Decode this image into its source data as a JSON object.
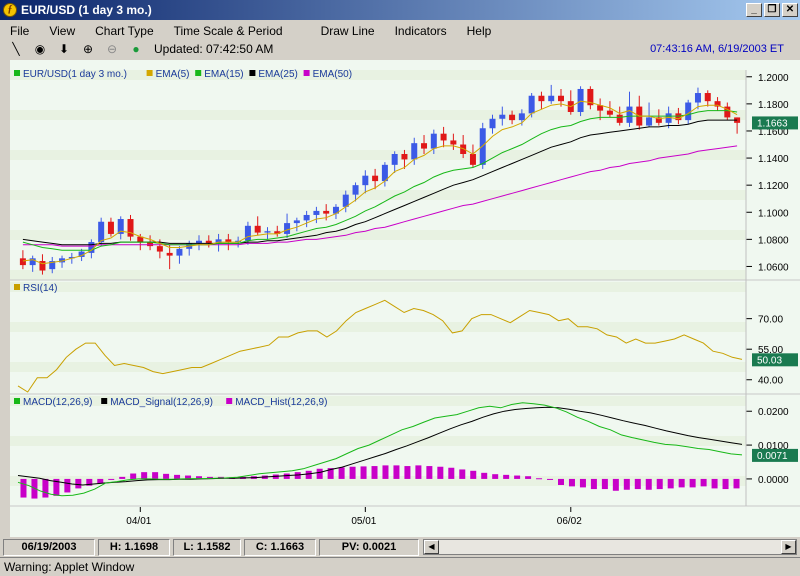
{
  "window": {
    "title": "EUR/USD (1 day  3 mo.)",
    "buttons": [
      "_",
      "❐",
      "✕"
    ]
  },
  "menu": [
    "File",
    "View",
    "Chart Type",
    "Time Scale & Period",
    "Draw Line",
    "Indicators",
    "Help"
  ],
  "toolbar": {
    "updated": "Updated: 07:42:50 AM",
    "clock": "07:43:16 AM, 6/19/2003 ET"
  },
  "status": {
    "date": "06/19/2003",
    "high": "H: 1.1698",
    "low": "L: 1.1582",
    "close": "C: 1.1663",
    "pv": "PV: 0.0021"
  },
  "warning": "Warning: Applet Window",
  "colors": {
    "up": "#3c5ae6",
    "down": "#e01818",
    "ema5": "#d4a800",
    "ema15": "#18b818",
    "ema25": "#000000",
    "ema50": "#c800c8",
    "rsi": "#c8a000",
    "macd": "#18b818",
    "signal": "#000000",
    "hist": "#c800c8",
    "last_badge": "#1a7a50"
  },
  "chart_data": [
    {
      "type": "candlestick",
      "legend": [
        "EUR/USD(1 day  3 mo.)",
        "EMA(5)",
        "EMA(15)",
        "EMA(25)",
        "EMA(50)"
      ],
      "yticks": [
        "1.2000",
        "1.1800",
        "1.1600",
        "1.1400",
        "1.1200",
        "1.1000",
        "1.0800",
        "1.0600"
      ],
      "ylim": [
        1.05,
        1.205
      ],
      "last_value": "1.1663",
      "xticks": [
        {
          "index": 12,
          "label": "04/01"
        },
        {
          "index": 35,
          "label": "05/01"
        },
        {
          "index": 56,
          "label": "06/02"
        }
      ],
      "candles": [
        {
          "o": 1.066,
          "h": 1.072,
          "l": 1.058,
          "c": 1.061
        },
        {
          "o": 1.061,
          "h": 1.068,
          "l": 1.056,
          "c": 1.066
        },
        {
          "o": 1.064,
          "h": 1.069,
          "l": 1.054,
          "c": 1.057
        },
        {
          "o": 1.058,
          "h": 1.067,
          "l": 1.055,
          "c": 1.064
        },
        {
          "o": 1.063,
          "h": 1.068,
          "l": 1.059,
          "c": 1.066
        },
        {
          "o": 1.066,
          "h": 1.07,
          "l": 1.062,
          "c": 1.067
        },
        {
          "o": 1.067,
          "h": 1.073,
          "l": 1.064,
          "c": 1.071
        },
        {
          "o": 1.07,
          "h": 1.08,
          "l": 1.066,
          "c": 1.078
        },
        {
          "o": 1.078,
          "h": 1.096,
          "l": 1.075,
          "c": 1.093
        },
        {
          "o": 1.093,
          "h": 1.096,
          "l": 1.082,
          "c": 1.084
        },
        {
          "o": 1.084,
          "h": 1.097,
          "l": 1.08,
          "c": 1.095
        },
        {
          "o": 1.095,
          "h": 1.098,
          "l": 1.079,
          "c": 1.082
        },
        {
          "o": 1.082,
          "h": 1.084,
          "l": 1.072,
          "c": 1.078
        },
        {
          "o": 1.078,
          "h": 1.083,
          "l": 1.072,
          "c": 1.075
        },
        {
          "o": 1.075,
          "h": 1.08,
          "l": 1.066,
          "c": 1.071
        },
        {
          "o": 1.07,
          "h": 1.076,
          "l": 1.058,
          "c": 1.068
        },
        {
          "o": 1.068,
          "h": 1.075,
          "l": 1.062,
          "c": 1.073
        },
        {
          "o": 1.073,
          "h": 1.079,
          "l": 1.068,
          "c": 1.077
        },
        {
          "o": 1.077,
          "h": 1.083,
          "l": 1.072,
          "c": 1.079
        },
        {
          "o": 1.079,
          "h": 1.083,
          "l": 1.074,
          "c": 1.077
        },
        {
          "o": 1.077,
          "h": 1.084,
          "l": 1.071,
          "c": 1.08
        },
        {
          "o": 1.08,
          "h": 1.084,
          "l": 1.072,
          "c": 1.078
        },
        {
          "o": 1.078,
          "h": 1.082,
          "l": 1.074,
          "c": 1.079
        },
        {
          "o": 1.079,
          "h": 1.093,
          "l": 1.076,
          "c": 1.09
        },
        {
          "o": 1.09,
          "h": 1.097,
          "l": 1.083,
          "c": 1.085
        },
        {
          "o": 1.085,
          "h": 1.089,
          "l": 1.08,
          "c": 1.086
        },
        {
          "o": 1.086,
          "h": 1.09,
          "l": 1.082,
          "c": 1.084
        },
        {
          "o": 1.084,
          "h": 1.099,
          "l": 1.081,
          "c": 1.092
        },
        {
          "o": 1.092,
          "h": 1.096,
          "l": 1.086,
          "c": 1.094
        },
        {
          "o": 1.094,
          "h": 1.101,
          "l": 1.089,
          "c": 1.098
        },
        {
          "o": 1.098,
          "h": 1.104,
          "l": 1.092,
          "c": 1.101
        },
        {
          "o": 1.101,
          "h": 1.106,
          "l": 1.094,
          "c": 1.099
        },
        {
          "o": 1.099,
          "h": 1.106,
          "l": 1.095,
          "c": 1.104
        },
        {
          "o": 1.104,
          "h": 1.116,
          "l": 1.1,
          "c": 1.113
        },
        {
          "o": 1.113,
          "h": 1.122,
          "l": 1.108,
          "c": 1.12
        },
        {
          "o": 1.12,
          "h": 1.131,
          "l": 1.114,
          "c": 1.127
        },
        {
          "o": 1.127,
          "h": 1.132,
          "l": 1.117,
          "c": 1.123
        },
        {
          "o": 1.123,
          "h": 1.137,
          "l": 1.119,
          "c": 1.135
        },
        {
          "o": 1.135,
          "h": 1.145,
          "l": 1.129,
          "c": 1.143
        },
        {
          "o": 1.143,
          "h": 1.146,
          "l": 1.132,
          "c": 1.139
        },
        {
          "o": 1.139,
          "h": 1.155,
          "l": 1.135,
          "c": 1.151
        },
        {
          "o": 1.151,
          "h": 1.157,
          "l": 1.143,
          "c": 1.147
        },
        {
          "o": 1.147,
          "h": 1.161,
          "l": 1.143,
          "c": 1.158
        },
        {
          "o": 1.158,
          "h": 1.163,
          "l": 1.148,
          "c": 1.153
        },
        {
          "o": 1.153,
          "h": 1.158,
          "l": 1.146,
          "c": 1.15
        },
        {
          "o": 1.15,
          "h": 1.157,
          "l": 1.14,
          "c": 1.143
        },
        {
          "o": 1.143,
          "h": 1.15,
          "l": 1.133,
          "c": 1.135
        },
        {
          "o": 1.135,
          "h": 1.166,
          "l": 1.132,
          "c": 1.162
        },
        {
          "o": 1.162,
          "h": 1.172,
          "l": 1.158,
          "c": 1.169
        },
        {
          "o": 1.169,
          "h": 1.178,
          "l": 1.164,
          "c": 1.172
        },
        {
          "o": 1.172,
          "h": 1.175,
          "l": 1.165,
          "c": 1.168
        },
        {
          "o": 1.168,
          "h": 1.176,
          "l": 1.164,
          "c": 1.173
        },
        {
          "o": 1.173,
          "h": 1.188,
          "l": 1.17,
          "c": 1.186
        },
        {
          "o": 1.186,
          "h": 1.189,
          "l": 1.176,
          "c": 1.182
        },
        {
          "o": 1.182,
          "h": 1.194,
          "l": 1.18,
          "c": 1.186
        },
        {
          "o": 1.186,
          "h": 1.191,
          "l": 1.178,
          "c": 1.182
        },
        {
          "o": 1.182,
          "h": 1.19,
          "l": 1.172,
          "c": 1.174
        },
        {
          "o": 1.174,
          "h": 1.193,
          "l": 1.171,
          "c": 1.191
        },
        {
          "o": 1.191,
          "h": 1.193,
          "l": 1.176,
          "c": 1.179
        },
        {
          "o": 1.179,
          "h": 1.184,
          "l": 1.168,
          "c": 1.175
        },
        {
          "o": 1.175,
          "h": 1.182,
          "l": 1.17,
          "c": 1.172
        },
        {
          "o": 1.172,
          "h": 1.178,
          "l": 1.164,
          "c": 1.166
        },
        {
          "o": 1.166,
          "h": 1.189,
          "l": 1.163,
          "c": 1.178
        },
        {
          "o": 1.178,
          "h": 1.186,
          "l": 1.161,
          "c": 1.164
        },
        {
          "o": 1.164,
          "h": 1.181,
          "l": 1.163,
          "c": 1.17
        },
        {
          "o": 1.17,
          "h": 1.176,
          "l": 1.164,
          "c": 1.166
        },
        {
          "o": 1.166,
          "h": 1.178,
          "l": 1.162,
          "c": 1.173
        },
        {
          "o": 1.173,
          "h": 1.177,
          "l": 1.165,
          "c": 1.168
        },
        {
          "o": 1.168,
          "h": 1.183,
          "l": 1.165,
          "c": 1.181
        },
        {
          "o": 1.181,
          "h": 1.192,
          "l": 1.176,
          "c": 1.188
        },
        {
          "o": 1.188,
          "h": 1.19,
          "l": 1.178,
          "c": 1.182
        },
        {
          "o": 1.182,
          "h": 1.185,
          "l": 1.175,
          "c": 1.178
        },
        {
          "o": 1.178,
          "h": 1.181,
          "l": 1.168,
          "c": 1.17
        },
        {
          "o": 1.17,
          "h": 1.17,
          "l": 1.158,
          "c": 1.166
        }
      ],
      "ema5": [
        1.064,
        1.065,
        1.062,
        1.063,
        1.064,
        1.066,
        1.068,
        1.072,
        1.079,
        1.081,
        1.086,
        1.085,
        1.082,
        1.08,
        1.077,
        1.074,
        1.074,
        1.075,
        1.076,
        1.076,
        1.078,
        1.078,
        1.078,
        1.082,
        1.083,
        1.084,
        1.084,
        1.087,
        1.089,
        1.092,
        1.095,
        1.096,
        1.099,
        1.104,
        1.109,
        1.115,
        1.118,
        1.123,
        1.13,
        1.133,
        1.139,
        1.142,
        1.147,
        1.149,
        1.149,
        1.147,
        1.143,
        1.149,
        1.156,
        1.161,
        1.163,
        1.166,
        1.173,
        1.176,
        1.179,
        1.18,
        1.178,
        1.182,
        1.181,
        1.179,
        1.177,
        1.173,
        1.175,
        1.171,
        1.171,
        1.169,
        1.17,
        1.169,
        1.173,
        1.178,
        1.179,
        1.179,
        1.176,
        1.172
      ],
      "ema15": [
        1.078,
        1.076,
        1.074,
        1.073,
        1.072,
        1.072,
        1.072,
        1.072,
        1.075,
        1.076,
        1.078,
        1.078,
        1.078,
        1.078,
        1.077,
        1.076,
        1.076,
        1.076,
        1.076,
        1.076,
        1.077,
        1.077,
        1.077,
        1.079,
        1.08,
        1.08,
        1.081,
        1.082,
        1.084,
        1.086,
        1.088,
        1.089,
        1.091,
        1.094,
        1.097,
        1.101,
        1.104,
        1.108,
        1.112,
        1.115,
        1.119,
        1.122,
        1.126,
        1.129,
        1.131,
        1.132,
        1.133,
        1.136,
        1.14,
        1.144,
        1.147,
        1.15,
        1.154,
        1.158,
        1.161,
        1.163,
        1.164,
        1.167,
        1.169,
        1.17,
        1.17,
        1.17,
        1.171,
        1.171,
        1.171,
        1.171,
        1.171,
        1.171,
        1.172,
        1.174,
        1.175,
        1.175,
        1.175,
        1.174
      ],
      "ema25": [
        1.08,
        1.079,
        1.078,
        1.077,
        1.076,
        1.076,
        1.076,
        1.076,
        1.077,
        1.077,
        1.078,
        1.078,
        1.078,
        1.078,
        1.078,
        1.077,
        1.077,
        1.077,
        1.077,
        1.077,
        1.077,
        1.077,
        1.077,
        1.078,
        1.078,
        1.079,
        1.079,
        1.08,
        1.081,
        1.082,
        1.083,
        1.085,
        1.086,
        1.088,
        1.091,
        1.093,
        1.096,
        1.099,
        1.102,
        1.105,
        1.108,
        1.111,
        1.114,
        1.117,
        1.12,
        1.122,
        1.124,
        1.127,
        1.13,
        1.133,
        1.136,
        1.139,
        1.142,
        1.145,
        1.148,
        1.15,
        1.152,
        1.155,
        1.157,
        1.158,
        1.159,
        1.16,
        1.161,
        1.162,
        1.163,
        1.163,
        1.164,
        1.164,
        1.165,
        1.167,
        1.168,
        1.168,
        1.168,
        1.168
      ],
      "ema50": [
        1.076,
        1.076,
        1.076,
        1.076,
        1.075,
        1.075,
        1.075,
        1.075,
        1.076,
        1.076,
        1.076,
        1.076,
        1.076,
        1.076,
        1.076,
        1.076,
        1.076,
        1.076,
        1.076,
        1.076,
        1.076,
        1.076,
        1.076,
        1.077,
        1.077,
        1.077,
        1.078,
        1.078,
        1.079,
        1.08,
        1.08,
        1.081,
        1.082,
        1.083,
        1.085,
        1.086,
        1.088,
        1.089,
        1.091,
        1.093,
        1.095,
        1.097,
        1.099,
        1.101,
        1.103,
        1.105,
        1.106,
        1.108,
        1.11,
        1.112,
        1.114,
        1.116,
        1.118,
        1.12,
        1.122,
        1.124,
        1.126,
        1.128,
        1.13,
        1.131,
        1.133,
        1.134,
        1.136,
        1.137,
        1.138,
        1.14,
        1.141,
        1.142,
        1.143,
        1.145,
        1.146,
        1.147,
        1.148,
        1.149
      ]
    },
    {
      "type": "line",
      "legend": [
        "RSI(14)"
      ],
      "yticks": [
        "70.00",
        "55.00",
        "40.00"
      ],
      "ylim": [
        33,
        88
      ],
      "last_value": "50.03",
      "values": [
        37,
        34,
        41,
        41,
        45,
        51,
        55,
        58,
        58,
        52,
        47,
        48,
        47,
        46,
        44,
        43,
        44,
        45,
        46,
        46,
        48,
        50,
        52,
        54,
        55,
        56,
        57,
        61,
        61,
        63,
        64,
        64,
        61,
        64,
        69,
        73,
        75,
        77,
        79,
        76,
        73,
        75,
        74,
        72,
        69,
        63,
        64,
        70,
        72,
        72,
        70,
        68,
        71,
        74,
        73,
        72,
        69,
        70,
        66,
        66,
        65,
        62,
        61,
        58,
        60,
        58,
        58,
        59,
        60,
        62,
        60,
        58,
        54,
        53,
        51,
        50
      ]
    },
    {
      "type": "line+bar",
      "legend": [
        "MACD(12,26,9)",
        "MACD_Signal(12,26,9)",
        "MACD_Hist(12,26,9)"
      ],
      "yticks": [
        "0.0200",
        "0.0100",
        "0.0000"
      ],
      "ylim": [
        -0.008,
        0.0245
      ],
      "last_value": "0.0071",
      "macd": [
        -0.001,
        -0.002,
        -0.0035,
        -0.0045,
        -0.005,
        -0.0048,
        -0.0042,
        -0.003,
        -0.0012,
        -0.0008,
        -0.0003,
        0.0,
        0.0,
        -0.0001,
        -0.0001,
        0.0,
        0.0001,
        0.0001,
        0.0002,
        0.0003,
        0.0005,
        0.001,
        0.0015,
        0.0018,
        0.0021,
        0.0024,
        0.003,
        0.004,
        0.005,
        0.006,
        0.0075,
        0.009,
        0.01,
        0.0115,
        0.013,
        0.0145,
        0.0155,
        0.0168,
        0.018,
        0.0185,
        0.019,
        0.02,
        0.021,
        0.0215,
        0.021,
        0.022,
        0.0225,
        0.0222,
        0.0218,
        0.021,
        0.0198,
        0.0182,
        0.017,
        0.0155,
        0.0145,
        0.013,
        0.0122,
        0.0115,
        0.0108,
        0.0102,
        0.01,
        0.0095,
        0.009,
        0.0087,
        0.008,
        0.0074,
        0.0071
      ],
      "signal": [
        0.001,
        0.0006,
        0.0002,
        -0.0005,
        -0.001,
        -0.0015,
        -0.0018,
        -0.0015,
        -0.0012,
        -0.001,
        -0.0008,
        -0.0005,
        -0.0003,
        -0.0002,
        -0.0002,
        -0.0001,
        -0.0001,
        0.0,
        0.0001,
        0.0002,
        0.0002,
        0.0003,
        0.0004,
        0.0006,
        0.0008,
        0.001,
        0.0012,
        0.0015,
        0.002,
        0.0028,
        0.0035,
        0.0045,
        0.0055,
        0.0065,
        0.0075,
        0.0087,
        0.0098,
        0.011,
        0.0122,
        0.0135,
        0.0148,
        0.016,
        0.017,
        0.0182,
        0.0192,
        0.02,
        0.0205,
        0.0208,
        0.021,
        0.0212,
        0.021,
        0.0206,
        0.02,
        0.0195,
        0.0188,
        0.018,
        0.0172,
        0.0165,
        0.0158,
        0.015,
        0.0142,
        0.0135,
        0.0128,
        0.0122,
        0.0117,
        0.0112,
        0.0107,
        0.0102
      ],
      "hist": [
        -0.0055,
        -0.0058,
        -0.0055,
        -0.005,
        -0.004,
        -0.0028,
        -0.002,
        -0.0013,
        -0.0002,
        0.0006,
        0.0016,
        0.002,
        0.002,
        0.0015,
        0.0012,
        0.001,
        0.0008,
        0.0006,
        0.0006,
        0.0005,
        0.0006,
        0.0008,
        0.001,
        0.0013,
        0.0016,
        0.002,
        0.0024,
        0.003,
        0.0032,
        0.0034,
        0.0036,
        0.0037,
        0.0038,
        0.004,
        0.004,
        0.0038,
        0.004,
        0.0038,
        0.0036,
        0.0033,
        0.0028,
        0.0024,
        0.0018,
        0.0014,
        0.0012,
        0.001,
        0.0008,
        0.0002,
        -0.0003,
        -0.0018,
        -0.0022,
        -0.0025,
        -0.003,
        -0.003,
        -0.0035,
        -0.0032,
        -0.003,
        -0.0032,
        -0.003,
        -0.0028,
        -0.0025,
        -0.0025,
        -0.0022,
        -0.0028,
        -0.003,
        -0.0028
      ]
    }
  ]
}
